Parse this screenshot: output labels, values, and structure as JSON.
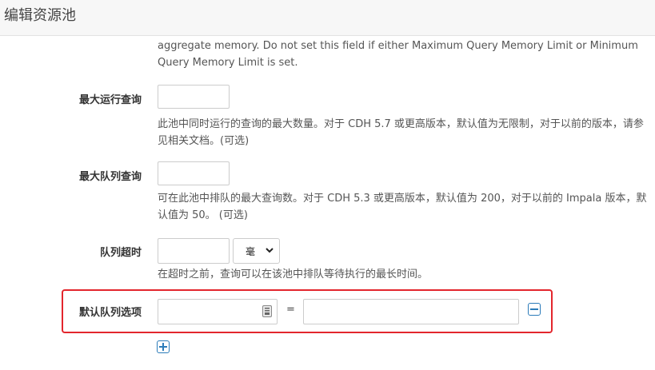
{
  "header": {
    "title": "编辑资源池"
  },
  "memory_help": "aggregate memory. Do not set this field if either Maximum Query Memory Limit or Minimum Query Memory Limit is set.",
  "max_running": {
    "label": "最大运行查询",
    "value": "",
    "help": "此池中同时运行的查询的最大数量。对于 CDH 5.7 或更高版本，默认值为无限制，对于以前的版本，请参见相关文档。(可选)"
  },
  "max_queued": {
    "label": "最大队列查询",
    "value": "",
    "help": "可在此池中排队的最大查询数。对于 CDH 5.3 或更高版本，默认值为 200，对于以前的 Impala 版本，默认值为 50。 (可选)"
  },
  "queue_timeout": {
    "label": "队列超时",
    "value": "",
    "unit": "毫",
    "help": "在超时之前，查询可以在该池中排队等待执行的最长时间。"
  },
  "default_query_options": {
    "label": "默认队列选项",
    "key_value": "",
    "equals": "=",
    "value_value": ""
  },
  "icons": {
    "remove": "minus-square-icon",
    "add": "plus-square-icon",
    "select": "chevron-down-icon",
    "input_helper": "keyboard-icon"
  },
  "colors": {
    "highlight": "#e3262d",
    "accent": "#2b7bb9"
  }
}
